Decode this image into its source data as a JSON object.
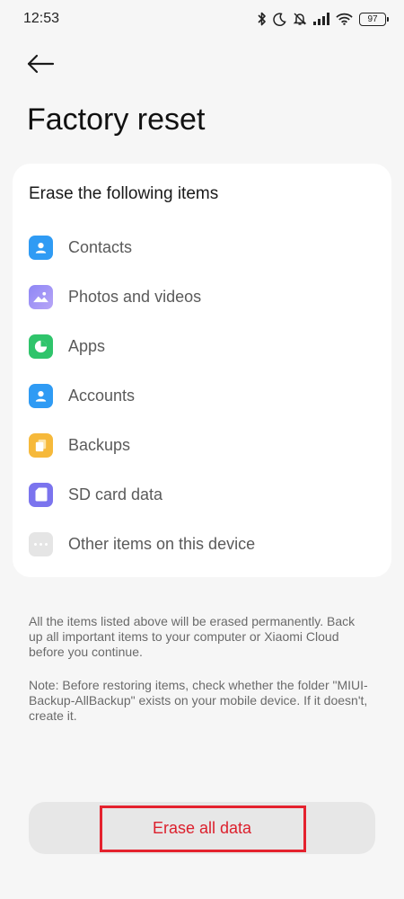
{
  "status_bar": {
    "time": "12:53",
    "battery": "97",
    "icons": [
      "bluetooth-icon",
      "moon-icon",
      "muted-bell-icon",
      "signal-icon",
      "wifi-icon",
      "battery-icon"
    ]
  },
  "header": {
    "back_icon": "back-arrow-icon",
    "title": "Factory reset"
  },
  "card": {
    "heading": "Erase the following items",
    "items": [
      {
        "label": "Contacts",
        "icon": "contacts-icon",
        "color": "#2f9bf4"
      },
      {
        "label": "Photos and videos",
        "icon": "gallery-icon",
        "color": "#8a7ff2"
      },
      {
        "label": "Apps",
        "icon": "apps-icon",
        "color": "#2fc46b"
      },
      {
        "label": "Accounts",
        "icon": "account-icon",
        "color": "#2f9bf4"
      },
      {
        "label": "Backups",
        "icon": "backup-icon",
        "color": "#f6b93b"
      },
      {
        "label": "SD card data",
        "icon": "sd-card-icon",
        "color": "#7b74ee"
      },
      {
        "label": "Other items on this device",
        "icon": "more-icon",
        "color": "#e5e5e5"
      }
    ]
  },
  "notes": {
    "warning": "All the items listed above will be erased permanently. Back up all important items to your computer or Xiaomi Cloud before you continue.",
    "restore_note": "Note: Before restoring items, check whether the folder \"MIUI-Backup-AllBackup\" exists on your mobile device. If it doesn't, create it."
  },
  "action": {
    "erase_label": "Erase all data"
  },
  "colors": {
    "background": "#f6f6f6",
    "card": "#ffffff",
    "button": "#e7e7e7",
    "button_text": "#dc1f2c",
    "highlight_border": "#e4222e"
  }
}
